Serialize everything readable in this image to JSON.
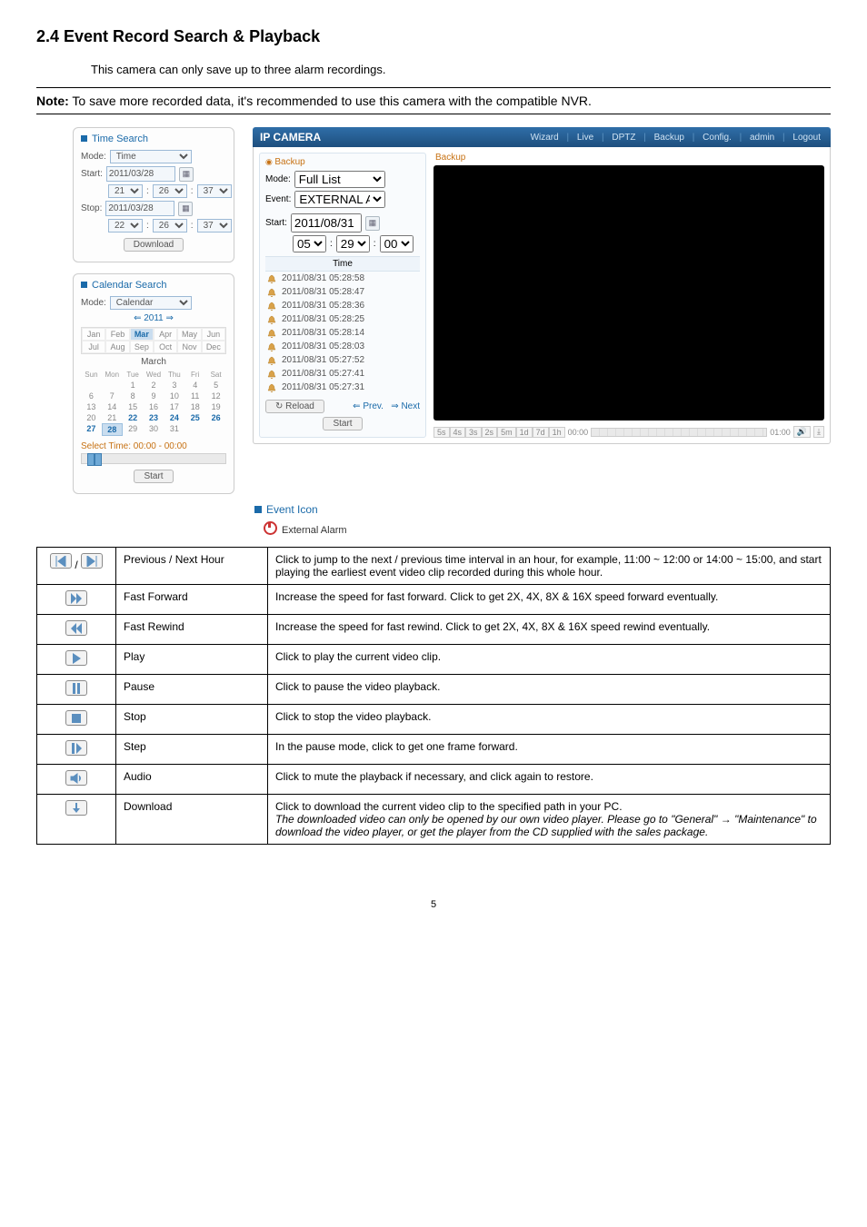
{
  "section": {
    "title": "2.4 Event Record Search & Playback",
    "intro": "This camera can only save up to three alarm recordings.",
    "note_label": "Note:",
    "note_text": "To save more recorded data, it's recommended to use this camera with the compatible NVR."
  },
  "time_search": {
    "title": "Time Search",
    "mode_label": "Mode:",
    "mode_value": "Time",
    "start_label": "Start:",
    "start_date": "2011/03/28",
    "start_h": "21",
    "start_m": "26",
    "start_s": "37",
    "stop_label": "Stop:",
    "stop_date": "2011/03/28",
    "stop_h": "22",
    "stop_m": "26",
    "stop_s": "37",
    "download_btn": "Download"
  },
  "calendar_search": {
    "title": "Calendar Search",
    "mode_label": "Mode:",
    "mode_value": "Calendar",
    "year_nav": "⇐ 2011 ⇒",
    "months": [
      "Jan",
      "Feb",
      "Mar",
      "Apr",
      "May",
      "Jun",
      "Jul",
      "Aug",
      "Sep",
      "Oct",
      "Nov",
      "Dec"
    ],
    "month_selected_index": 2,
    "month_title": "March",
    "dow": [
      "Sun",
      "Mon",
      "Tue",
      "Wed",
      "Thu",
      "Fri",
      "Sat"
    ],
    "days_bold": [
      22,
      23,
      24,
      25,
      26,
      27
    ],
    "day_selected": 28,
    "select_time_label": "Select Time: 00:00 - 00:00",
    "start_btn": "Start"
  },
  "ip_camera": {
    "title": "IP CAMERA",
    "links": [
      "Wizard",
      "Live",
      "DPTZ",
      "Backup",
      "Config.",
      "admin",
      "Logout"
    ],
    "backup_tab": "Backup",
    "mode_label": "Mode:",
    "mode_value": "Full List",
    "event_label": "Event:",
    "event_value": "EXTERNAL ALARM;---",
    "start_label": "Start:",
    "start_date": "2011/08/31",
    "start_h": "05",
    "start_m": "29",
    "start_s": "00",
    "list_header": "Time",
    "events": [
      "2011/08/31 05:28:58",
      "2011/08/31 05:28:47",
      "2011/08/31 05:28:36",
      "2011/08/31 05:28:25",
      "2011/08/31 05:28:14",
      "2011/08/31 05:28:03",
      "2011/08/31 05:27:52",
      "2011/08/31 05:27:41",
      "2011/08/31 05:27:31"
    ],
    "reload_btn": "Reload",
    "prev_btn": "⇐ Prev.",
    "next_btn": "⇒ Next",
    "start_btn": "Start",
    "right_tab": "Backup",
    "timeline_segments": [
      "5s",
      "4s",
      "3s",
      "2s",
      "5m",
      "1d",
      "7d",
      "1h"
    ],
    "timeline_left": "00:00",
    "timeline_right": "01:00"
  },
  "event_icon_section": {
    "title": "Event Icon",
    "external_alarm": "External Alarm"
  },
  "icon_table": [
    {
      "svg": "prev-next-hour",
      "name": "Previous / Next Hour",
      "desc": "Click to jump to the next / previous time interval in an hour, for example, 11:00 ~ 12:00 or 14:00 ~ 15:00, and start playing the earliest event video clip recorded during this whole hour."
    },
    {
      "svg": "fast-forward",
      "name": "Fast Forward",
      "desc": "Increase the speed for fast forward. Click to get 2X, 4X, 8X & 16X speed forward eventually."
    },
    {
      "svg": "fast-rewind",
      "name": "Fast Rewind",
      "desc": "Increase the speed for fast rewind. Click to get 2X, 4X, 8X & 16X speed rewind eventually."
    },
    {
      "svg": "play",
      "name": "Play",
      "desc": "Click to play the current video clip."
    },
    {
      "svg": "pause",
      "name": "Pause",
      "desc": "Click to pause the video playback."
    },
    {
      "svg": "stop",
      "name": "Stop",
      "desc": "Click to stop the video playback."
    },
    {
      "svg": "step",
      "name": "Step",
      "desc": "In the pause mode, click to get one frame forward."
    },
    {
      "svg": "audio",
      "name": "Audio",
      "desc": "Click to mute the playback if necessary, and click again to restore."
    },
    {
      "svg": "download",
      "name": "Download",
      "desc": "Click to download the current video clip to the specified path in your PC.",
      "desc2": "The downloaded video can only be opened by our own video player. Please go to \"General\" → \"Maintenance\" to download the video player, or get the player from the CD supplied with the sales package."
    }
  ],
  "page_number": "5"
}
